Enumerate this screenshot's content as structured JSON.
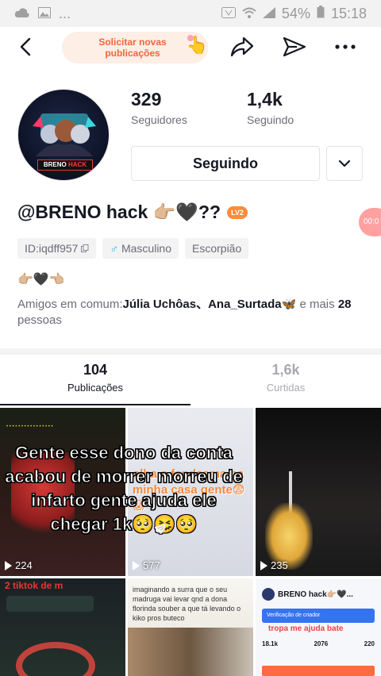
{
  "status_bar": {
    "battery": "54%",
    "time": "15:18",
    "dots": "..."
  },
  "top_nav": {
    "request_button": "Solicitar novas publicações"
  },
  "profile": {
    "handle": "@BRENO hack 👉🏼🖤??",
    "level": "LV2",
    "avatar_tag_white": "BRENO",
    "avatar_tag_red": "HACK",
    "followers_count": "329",
    "followers_label": "Seguidores",
    "following_count": "1,4k",
    "following_label": "Seguindo",
    "follow_button": "Seguindo",
    "chips": {
      "id": "ID:iqdff957",
      "gender": "Masculino",
      "zodiac": "Escorpião"
    },
    "bio": "👉🏼🖤👈🏼",
    "mutual_prefix": "Amigos em comum:",
    "mutual_names": "Júlia Uchôas、Ana_Surtada🦋",
    "mutual_suffix": " e mais ",
    "mutual_count": "28",
    "mutual_end": " pessoas",
    "side_bubble": "00:0"
  },
  "tabs": [
    {
      "count": "104",
      "label": "Publicações"
    },
    {
      "count": "1,6k",
      "label": "Curtidas"
    }
  ],
  "grid": {
    "caption": "Gente esse dono da conta acabou de morrer morreu de infarto gente ajuda ele chegar 1k🥺🤧🥺",
    "cells": [
      {
        "views": "224"
      },
      {
        "views": "577",
        "overlay": "olha o fandasma na minha casa gente😨😱"
      },
      {
        "views": "235"
      },
      {
        "overlay": "2 tiktok de m"
      },
      {
        "overlay": "imaginando a surra que o seu madruga vai levar qnd a dona florinda souber a que tá levando o kiko pros buteco"
      },
      {
        "header": "BRENO hack👉🏼🖤...",
        "verify": "Verificação de criador",
        "overlay": "tropa me ajuda bate",
        "stats": [
          "18.1k",
          "2076",
          "220"
        ]
      }
    ]
  }
}
